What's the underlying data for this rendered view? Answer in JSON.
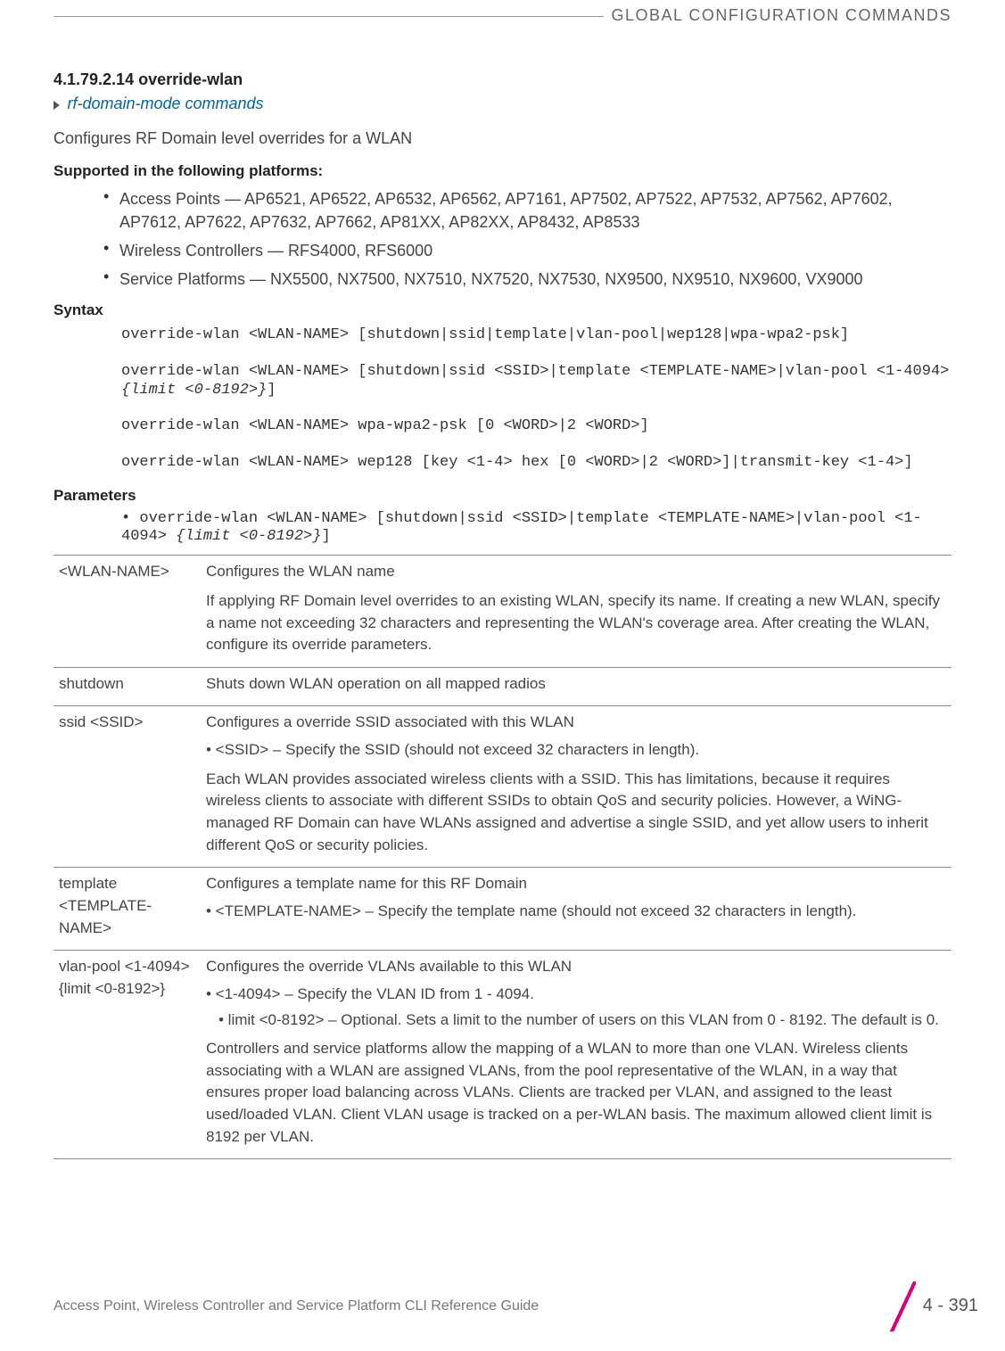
{
  "header": {
    "title": "GLOBAL CONFIGURATION COMMANDS"
  },
  "section": {
    "number_title": "4.1.79.2.14 override-wlan",
    "link": "rf-domain-mode commands",
    "intro": "Configures RF Domain level overrides for a WLAN",
    "supported_head": "Supported in the following platforms:",
    "platforms": [
      "Access Points — AP6521, AP6522, AP6532, AP6562, AP7161, AP7502, AP7522, AP7532, AP7562, AP7602, AP7612, AP7622, AP7632, AP7662, AP81XX, AP82XX, AP8432, AP8533",
      "Wireless Controllers — RFS4000, RFS6000",
      "Service Platforms — NX5500, NX7500, NX7510, NX7520, NX7530, NX9500, NX9510, NX9600, VX9000"
    ],
    "syntax_head": "Syntax",
    "syntax_lines": {
      "l1": "override-wlan <WLAN-NAME> [shutdown|ssid|template|vlan-pool|wep128|wpa-wpa2-psk]",
      "l2a": "override-wlan <WLAN-NAME> [shutdown|ssid <SSID>|template <TEMPLATE-NAME>|vlan-pool <1-4094> ",
      "l2b_ital": "{limit <0-8192>}",
      "l2c": "]",
      "l3": "override-wlan <WLAN-NAME> wpa-wpa2-psk [0 <WORD>|2 <WORD>]",
      "l4": "override-wlan <WLAN-NAME> wep128 [key <1-4> hex [0 <WORD>|2 <WORD>]|transmit-key <1-4>]"
    },
    "params_head": "Parameters",
    "param_cmd": {
      "prefix": "• override-wlan <WLAN-NAME> [shutdown|ssid <SSID>|template <TEMPLATE-NAME>|vlan-pool <1-4094> ",
      "ital": "{limit <0-8192>}",
      "suffix": "]"
    }
  },
  "table": {
    "r1": {
      "name": "<WLAN-NAME>",
      "l1": "Configures the WLAN name",
      "l2": "If applying RF Domain level overrides to an existing WLAN, specify its name. If creating a new WLAN, specify a name not exceeding 32 characters and representing the WLAN's coverage area. After creating the WLAN, configure its override parameters."
    },
    "r2": {
      "name": "shutdown",
      "l1": "Shuts down WLAN operation on all mapped radios"
    },
    "r3": {
      "name": "ssid <SSID>",
      "l1": "Configures a override SSID associated with this WLAN",
      "b1": "• <SSID> – Specify the SSID (should not exceed 32 characters in length).",
      "l2": "Each WLAN provides associated wireless clients with a SSID. This has limitations, because it requires wireless clients to associate with different SSIDs to obtain QoS and security policies. However, a WiNG-managed RF Domain can have WLANs assigned and advertise a single SSID, and yet allow users to inherit different QoS or security policies."
    },
    "r4": {
      "name": "template <TEMPLATE-NAME>",
      "l1": "Configures a template name for this RF Domain",
      "b1": "• <TEMPLATE-NAME> – Specify the template name (should not exceed 32 characters in length)."
    },
    "r5": {
      "name": "vlan-pool <1-4094> {limit <0-8192>}",
      "l1": "Configures the override VLANs available to this WLAN",
      "b1": "• <1-4094> – Specify the VLAN ID from 1 - 4094.",
      "b2": "• limit <0-8192> – Optional. Sets a limit to the number of users on this VLAN from 0 - 8192. The default is 0.",
      "l2": "Controllers and service platforms allow the mapping of a WLAN to more than one VLAN. Wireless clients associating with a WLAN are assigned VLANs, from the pool representative of the WLAN, in a way that ensures proper load balancing across VLANs. Clients are tracked per VLAN, and assigned to the least used/loaded VLAN. Client VLAN usage is tracked on a per-WLAN basis. The maximum allowed client limit is 8192 per VLAN."
    }
  },
  "footer": {
    "guide": "Access Point, Wireless Controller and Service Platform CLI Reference Guide",
    "page": "4 - 391"
  },
  "chart_data": null
}
